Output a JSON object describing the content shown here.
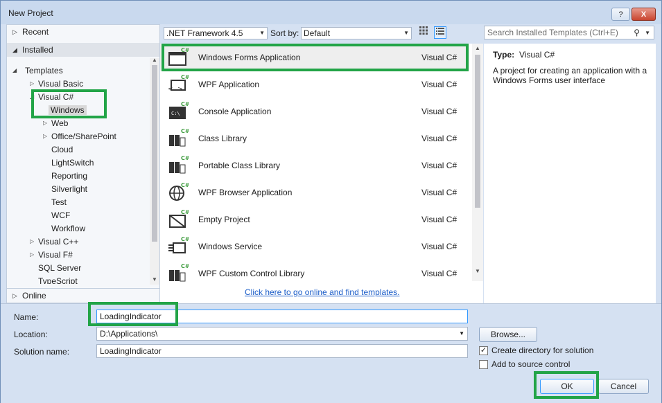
{
  "window": {
    "title": "New Project",
    "help_label": "?",
    "close_label": "X"
  },
  "left": {
    "recent_label": "Recent",
    "installed_label": "Installed",
    "online_label": "Online",
    "tree": {
      "templates": "Templates",
      "visual_basic": "Visual Basic",
      "visual_csharp": "Visual C#",
      "windows": "Windows",
      "web": "Web",
      "office_sharepoint": "Office/SharePoint",
      "cloud": "Cloud",
      "lightswitch": "LightSwitch",
      "reporting": "Reporting",
      "silverlight": "Silverlight",
      "test": "Test",
      "wcf": "WCF",
      "workflow": "Workflow",
      "visual_cpp": "Visual C++",
      "visual_fsharp": "Visual F#",
      "sql_server": "SQL Server",
      "typescript": "TypeScript"
    }
  },
  "toolbar": {
    "framework": ".NET Framework 4.5",
    "sort_label": "Sort by:",
    "sort_value": "Default"
  },
  "templates": [
    {
      "name": "Windows Forms Application",
      "lang": "Visual C#",
      "icon": "windows-forms-icon"
    },
    {
      "name": "WPF Application",
      "lang": "Visual C#",
      "icon": "wpf-app-icon"
    },
    {
      "name": "Console Application",
      "lang": "Visual C#",
      "icon": "console-icon"
    },
    {
      "name": "Class Library",
      "lang": "Visual C#",
      "icon": "class-library-icon"
    },
    {
      "name": "Portable Class Library",
      "lang": "Visual C#",
      "icon": "portable-library-icon"
    },
    {
      "name": "WPF Browser Application",
      "lang": "Visual C#",
      "icon": "globe-icon"
    },
    {
      "name": "Empty Project",
      "lang": "Visual C#",
      "icon": "empty-project-icon"
    },
    {
      "name": "Windows Service",
      "lang": "Visual C#",
      "icon": "windows-service-icon"
    },
    {
      "name": "WPF Custom Control Library",
      "lang": "Visual C#",
      "icon": "custom-control-icon"
    }
  ],
  "online_link": "Click here to go online and find templates.",
  "search": {
    "placeholder": "Search Installed Templates (Ctrl+E)"
  },
  "details": {
    "type_label": "Type:",
    "type_value": "Visual C#",
    "description": "A project for creating an application with a Windows Forms user interface"
  },
  "form": {
    "name_label": "Name:",
    "name_value": "LoadingIndicator",
    "location_label": "Location:",
    "location_value": "D:\\Applications\\",
    "solution_label": "Solution name:",
    "solution_value": "LoadingIndicator",
    "browse_label": "Browse...",
    "create_dir_label": "Create directory for solution",
    "source_control_label": "Add to source control",
    "create_dir_checked": true,
    "source_control_checked": false,
    "ok_label": "OK",
    "cancel_label": "Cancel"
  },
  "colors": {
    "highlight": "#22a447",
    "csharp_badge": "#3a9a3a",
    "link": "#1a5cc8"
  }
}
